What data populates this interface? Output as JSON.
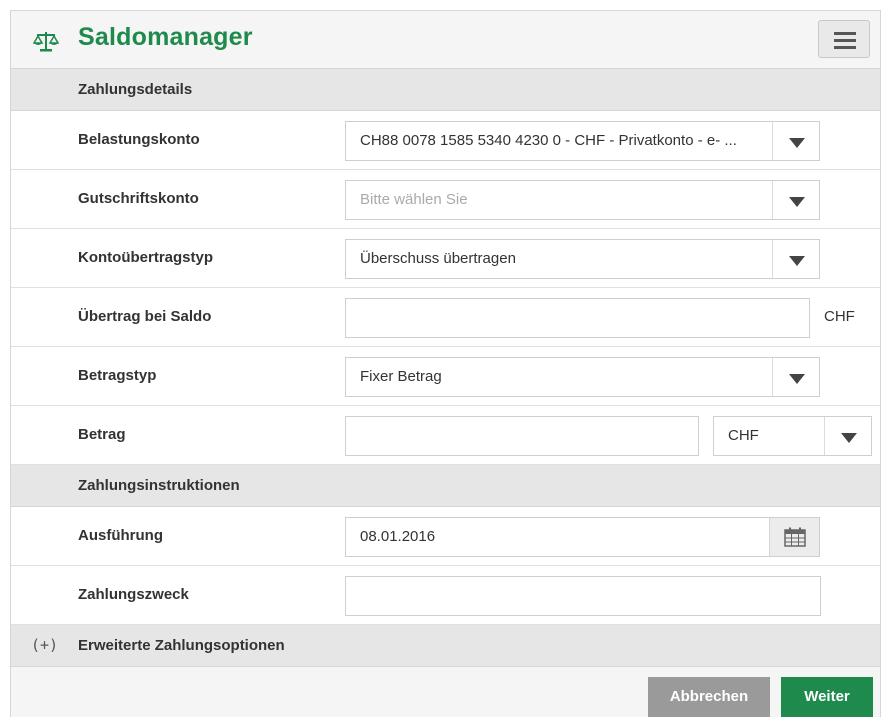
{
  "app": {
    "title": "Saldomanager",
    "accent": "#1e8a4c",
    "logo_icon": "scales-icon",
    "menu_icon": "hamburger-menu-icon"
  },
  "sections": {
    "details": "Zahlungsdetails",
    "instructions": "Zahlungsinstruktionen",
    "extended": "Erweiterte Zahlungsoptionen",
    "extended_icon_text": "(+)"
  },
  "fields": {
    "belastungskonto": {
      "label": "Belastungskonto",
      "value": "CH88 0078 1585 5340 4230 0 - CHF - Privatkonto - e- ..."
    },
    "gutschriftskonto": {
      "label": "Gutschriftskonto",
      "placeholder": "Bitte wählen Sie"
    },
    "kontouebertragstyp": {
      "label": "Kontoübertragstyp",
      "value": "Überschuss übertragen"
    },
    "uebertrag_bei_saldo": {
      "label": "Übertrag bei Saldo",
      "value": "",
      "unit": "CHF"
    },
    "betragstyp": {
      "label": "Betragstyp",
      "value": "Fixer Betrag"
    },
    "betrag": {
      "label": "Betrag",
      "value": "",
      "currency": "CHF"
    },
    "ausfuehrung": {
      "label": "Ausführung",
      "value": "08.01.2016",
      "icon": "calendar-icon"
    },
    "zahlungszweck": {
      "label": "Zahlungszweck",
      "value": ""
    }
  },
  "buttons": {
    "cancel": "Abbrechen",
    "next": "Weiter"
  }
}
